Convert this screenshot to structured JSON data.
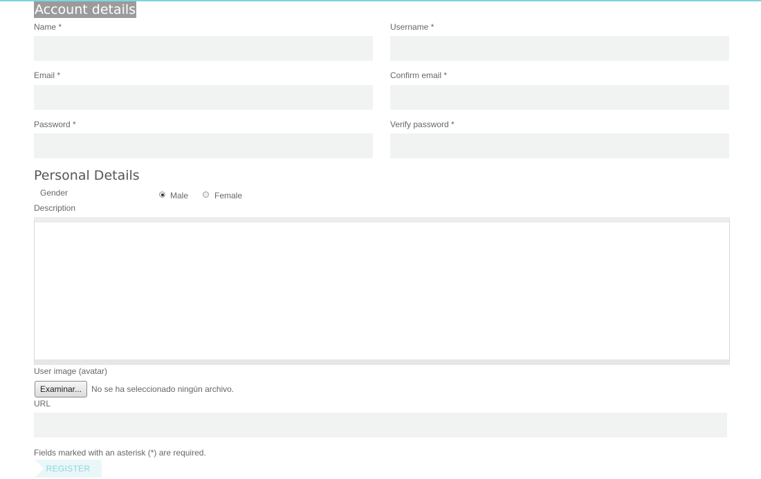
{
  "account": {
    "title": "Account details",
    "name_label": "Name *",
    "username_label": "Username *",
    "email_label": "Email *",
    "confirm_email_label": "Confirm email *",
    "password_label": "Password *",
    "verify_password_label": "Verify password *",
    "name_value": "",
    "username_value": "",
    "email_value": "",
    "confirm_email_value": "",
    "password_value": "",
    "verify_password_value": ""
  },
  "personal": {
    "title": "Personal Details",
    "gender_label": "Gender",
    "gender_options": [
      {
        "label": "Male",
        "checked": true
      },
      {
        "label": "Female",
        "checked": false
      }
    ],
    "description_label": "Description",
    "description_value": "",
    "avatar_label": "User image (avatar)",
    "browse_button_label": "Examinar...",
    "no_file_text": "No se ha seleccionado ningún archivo.",
    "url_label": "URL",
    "url_value": ""
  },
  "footer": {
    "required_note": "Fields marked with an asterisk (*) are required.",
    "register_label": "REGISTER"
  },
  "colors": {
    "accent": "#7fd3de",
    "input_bg": "#f1f3f3",
    "title_highlight": "#9b9b9b",
    "register_bg": "#e9f7f9",
    "register_text": "#8fd3dd"
  }
}
